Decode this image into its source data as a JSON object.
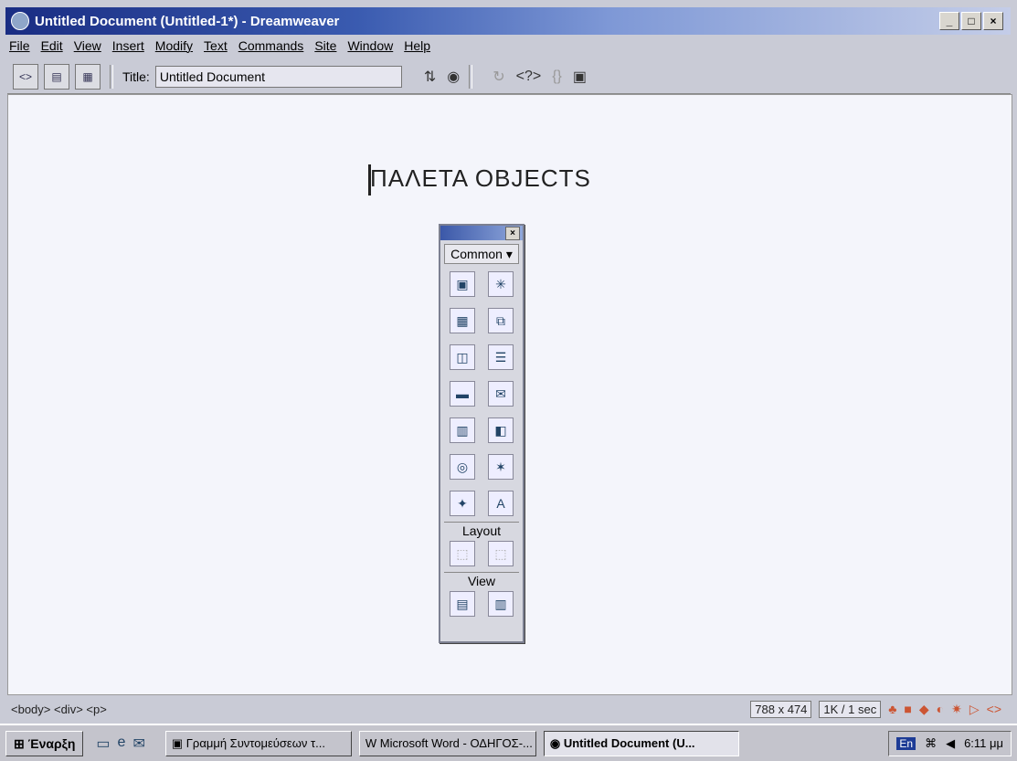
{
  "window": {
    "title": "Untitled Document (Untitled-1*) - Dreamweaver",
    "controls": [
      "_",
      "□",
      "×"
    ]
  },
  "menubar": {
    "items": [
      "File",
      "Edit",
      "View",
      "Insert",
      "Modify",
      "Text",
      "Commands",
      "Site",
      "Window",
      "Help"
    ]
  },
  "toolbar": {
    "title_label": "Title:",
    "title_value": "Untitled Document"
  },
  "document": {
    "heading": "ΠΑΛΕΤΑ OBJECTS"
  },
  "palette": {
    "close": "×",
    "category": "Common",
    "layout_label": "Layout",
    "view_label": "View"
  },
  "statusbar": {
    "tags": "<body> <div> <p>",
    "size": "788 x 474",
    "download": "1K / 1 sec"
  },
  "taskbar": {
    "start": "Έναρξη",
    "tasks": [
      "Γραμμή Συντομεύσεων τ...",
      "Microsoft Word - ΟΔΗΓΟΣ-...",
      "Untitled Document (U..."
    ],
    "lang": "En",
    "clock": "6:11 μμ"
  }
}
